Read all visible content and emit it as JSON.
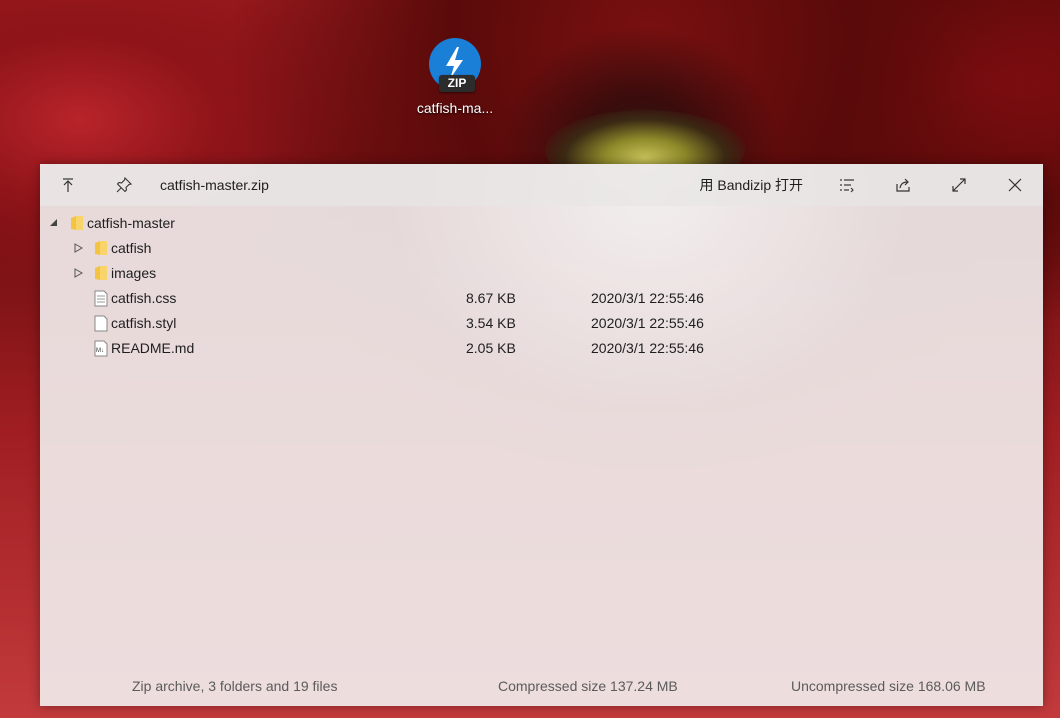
{
  "desktop": {
    "icon_label": "catfish-ma...",
    "icon_badge": "ZIP"
  },
  "window": {
    "title": "catfish-master.zip",
    "open_with_label": "用 Bandizip 打开",
    "tree": [
      {
        "name": "catfish-master",
        "kind": "folder",
        "level": 0,
        "expanded": true,
        "size": "",
        "date": ""
      },
      {
        "name": "catfish",
        "kind": "folder",
        "level": 1,
        "expanded": false,
        "size": "",
        "date": ""
      },
      {
        "name": "images",
        "kind": "folder",
        "level": 1,
        "expanded": false,
        "size": "",
        "date": ""
      },
      {
        "name": "catfish.css",
        "kind": "file-text",
        "level": 1,
        "size": "8.67 KB",
        "date": "2020/3/1 22:55:46"
      },
      {
        "name": "catfish.styl",
        "kind": "file-blank",
        "level": 1,
        "size": "3.54 KB",
        "date": "2020/3/1 22:55:46"
      },
      {
        "name": "README.md",
        "kind": "file-md",
        "level": 1,
        "size": "2.05 KB",
        "date": "2020/3/1 22:55:46"
      }
    ],
    "status": {
      "summary": "Zip archive, 3 folders and 19 files",
      "compressed": "Compressed size 137.24 MB",
      "uncompressed": "Uncompressed size 168.06 MB"
    }
  },
  "colors": {
    "accent": "#1a7fd6",
    "folder": "#f5c342"
  }
}
